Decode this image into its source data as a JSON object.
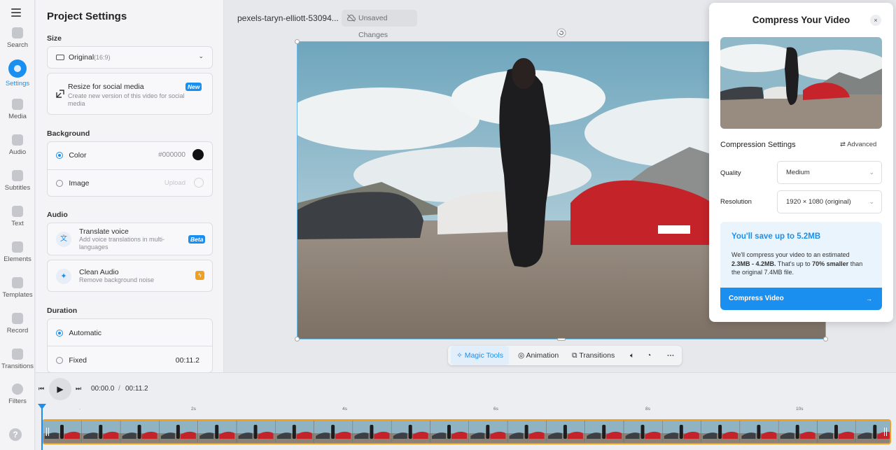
{
  "rail": {
    "items": [
      {
        "label": "Search",
        "icon": "search-icon"
      },
      {
        "label": "Settings",
        "icon": "settings-icon"
      },
      {
        "label": "Media",
        "icon": "plus-icon"
      },
      {
        "label": "Audio",
        "icon": "music-icon"
      },
      {
        "label": "Subtitles",
        "icon": "subtitles-icon"
      },
      {
        "label": "Text",
        "icon": "text-icon"
      },
      {
        "label": "Elements",
        "icon": "elements-icon"
      },
      {
        "label": "Templates",
        "icon": "templates-icon"
      },
      {
        "label": "Record",
        "icon": "record-icon"
      },
      {
        "label": "Transitions",
        "icon": "transitions-icon"
      },
      {
        "label": "Filters",
        "icon": "filters-icon"
      }
    ],
    "help": "?"
  },
  "panel": {
    "title": "Project Settings",
    "size": {
      "heading": "Size",
      "selected": "Original",
      "ratio": "(16:9)",
      "resize_title": "Resize for social media",
      "resize_desc": "Create new version of this video for social media",
      "resize_badge": "New"
    },
    "background": {
      "heading": "Background",
      "color_label": "Color",
      "color_value": "#000000",
      "image_label": "Image",
      "upload_label": "Upload"
    },
    "audio": {
      "heading": "Audio",
      "translate_title": "Translate voice",
      "translate_desc": "Add voice translations in multi-languages",
      "translate_badge": "Beta",
      "clean_title": "Clean Audio",
      "clean_desc": "Remove background noise"
    },
    "duration": {
      "heading": "Duration",
      "automatic": "Automatic",
      "fixed": "Fixed",
      "fixed_value": "00:11.2"
    }
  },
  "topbar": {
    "filename": "pexels-taryn-elliott-53094...",
    "unsaved": "Unsaved Changes"
  },
  "toolbar": {
    "magic": "Magic Tools",
    "animation": "Animation",
    "transitions": "Transitions"
  },
  "player": {
    "current": "00:00.0",
    "separator": "/",
    "total": "00:11.2",
    "ticks": [
      "2s",
      "4s",
      "6s",
      "8s",
      "10s"
    ]
  },
  "modal": {
    "title": "Compress Your Video",
    "close": "×",
    "settings_heading": "Compression Settings",
    "advanced": "Advanced",
    "quality_label": "Quality",
    "quality_value": "Medium",
    "resolution_label": "Resolution",
    "resolution_value": "1920 × 1080 (original)",
    "save_title": "You'll save up to 5.2MB",
    "save_text_1": "We'll compress your video to an estimated",
    "save_range": "2.3MB - 4.2MB.",
    "save_text_2": "That's up to",
    "save_pct": "70% smaller",
    "save_text_3": "than",
    "save_text_4": "the original 7.4MB file.",
    "button": "Compress Video",
    "button_arrow": "→"
  },
  "colors": {
    "accent": "#1a8ff0",
    "track_border": "#f0a020"
  }
}
